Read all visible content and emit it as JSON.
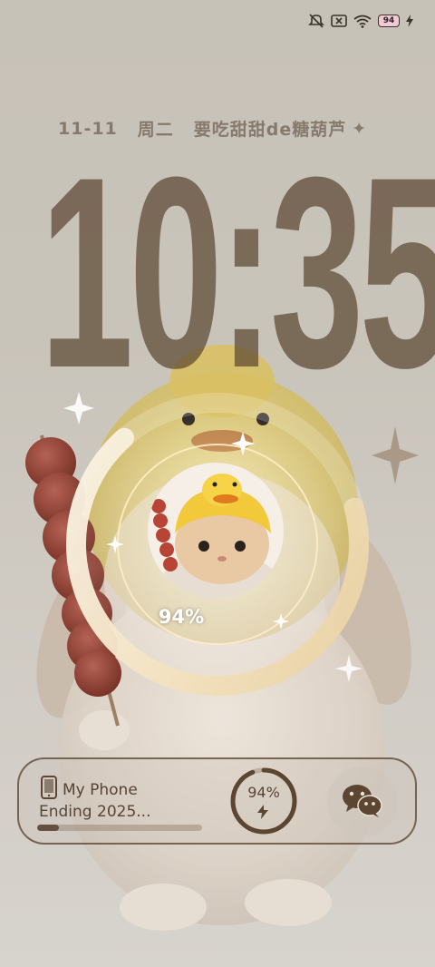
{
  "status_bar": {
    "icons": [
      "mute-vibrate-icon",
      "no-sim-icon",
      "wifi-icon",
      "battery-icon",
      "charging-bolt-icon"
    ],
    "battery_level": "94"
  },
  "lock_screen": {
    "date": "11-11",
    "weekday": "周二",
    "motto": "要吃甜甜de糖葫芦",
    "motto_decoration": "✦",
    "clock": {
      "digits": [
        "1",
        "0",
        ":",
        "3",
        "5"
      ]
    }
  },
  "charging": {
    "percent_text": "94%",
    "percent_value": 94
  },
  "device_widget": {
    "name": "My Phone",
    "status": "Ending 2025...",
    "progress": 0.13,
    "battery_text": "94%",
    "battery_value": 94,
    "device_icon": "phone-icon",
    "app_icon": "wechat-icon"
  },
  "colors": {
    "clock": "#5c4632",
    "ring_light": "#f3e3c4",
    "card_border": "#604a36"
  }
}
